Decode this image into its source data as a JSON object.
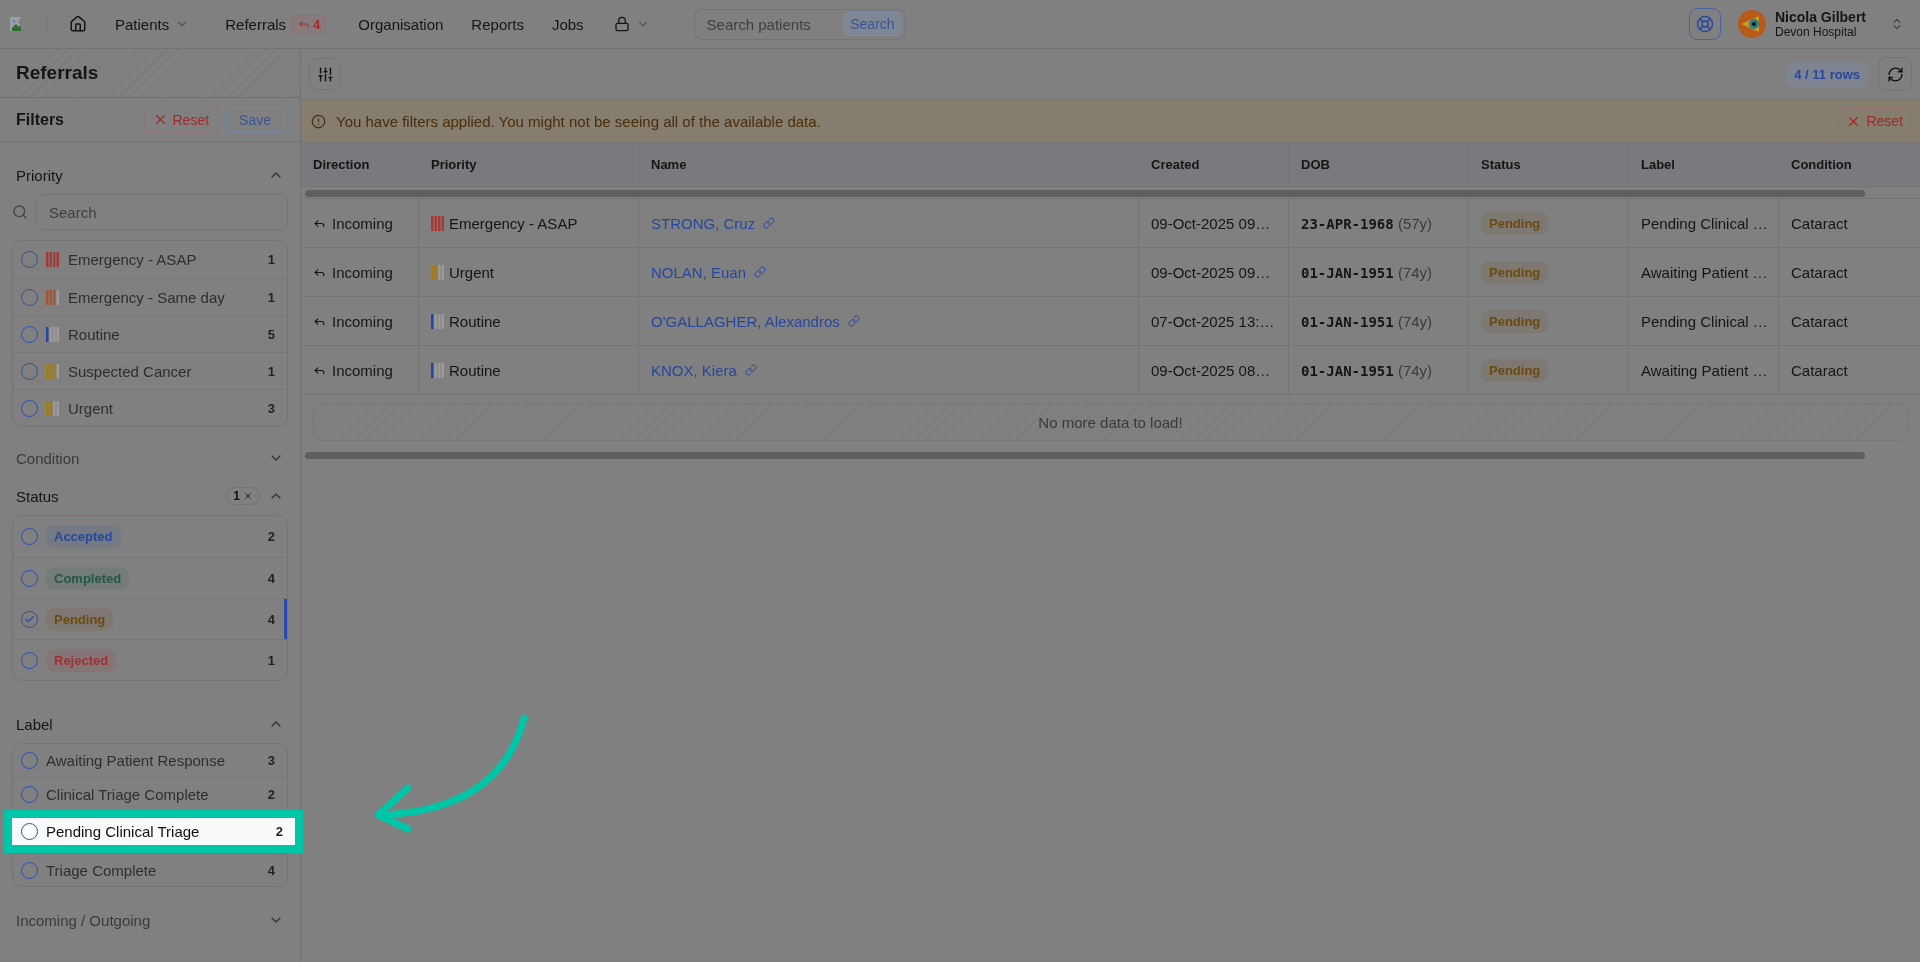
{
  "nav": {
    "items": [
      {
        "kind": "home"
      },
      {
        "kind": "menu",
        "label": "Patients"
      },
      {
        "kind": "badge-link",
        "label": "Referrals",
        "badge": "4"
      },
      {
        "kind": "link",
        "label": "Organisation"
      },
      {
        "kind": "link",
        "label": "Reports"
      },
      {
        "kind": "link",
        "label": "Jobs"
      },
      {
        "kind": "lock-menu"
      }
    ],
    "search": {
      "placeholder": "Search patients",
      "button": "Search"
    },
    "user": {
      "name": "Nicola Gilbert",
      "org": "Devon Hospital"
    }
  },
  "sidebar": {
    "title": "Referrals",
    "filters_title": "Filters",
    "reset": "Reset",
    "save": "Save",
    "sections": [
      {
        "kind": "priority",
        "title": "Priority",
        "expanded": true,
        "search_placeholder": "Search",
        "options": [
          {
            "label": "Emergency - ASAP",
            "count": "1",
            "checked": false,
            "kind": "asap",
            "color": "#a33a3a"
          },
          {
            "label": "Emergency - Same day",
            "count": "1",
            "checked": false,
            "kind": "sameday",
            "color": "#a5552f"
          },
          {
            "label": "Routine",
            "count": "5",
            "checked": false,
            "kind": "routine",
            "color": "#2647a0"
          },
          {
            "label": "Suspected Cancer",
            "count": "1",
            "checked": false,
            "kind": "cancer",
            "color": "#a57c10"
          },
          {
            "label": "Urgent",
            "count": "3",
            "checked": false,
            "kind": "urgent",
            "color": "#a57c10"
          }
        ]
      },
      {
        "kind": "plain",
        "title": "Condition",
        "expanded": false
      },
      {
        "kind": "status",
        "title": "Status",
        "expanded": true,
        "applied": "1",
        "options": [
          {
            "label": "Accepted",
            "count": "2",
            "checked": false,
            "color": "#27489e"
          },
          {
            "label": "Completed",
            "count": "4",
            "checked": false,
            "color": "#1d5a45"
          },
          {
            "label": "Pending",
            "count": "4",
            "checked": true,
            "color": "#6b4a10"
          },
          {
            "label": "Rejected",
            "count": "1",
            "checked": false,
            "color": "#a33030"
          }
        ]
      },
      {
        "kind": "plain",
        "title": "Label",
        "expanded": true,
        "options": [
          {
            "label": "Awaiting Patient Response",
            "count": "3",
            "checked": false,
            "highlighted": false
          },
          {
            "label": "Clinical Triage Complete",
            "count": "2",
            "checked": false,
            "highlighted": false
          },
          {
            "label": "Pending Clinical Triage",
            "count": "2",
            "checked": false,
            "highlighted": true
          },
          {
            "label": "Triage Complete",
            "count": "4",
            "checked": false,
            "highlighted": false
          }
        ]
      },
      {
        "kind": "plain",
        "title": "Incoming / Outgoing",
        "expanded": false
      }
    ]
  },
  "main": {
    "rows_count": "4 / 11 rows",
    "banner": "You have filters applied. You might not be seeing all of the available data.",
    "banner_reset": "Reset",
    "table": {
      "columns": [
        "Direction",
        "Priority",
        "Name",
        "Created",
        "DOB",
        "Status",
        "Label",
        "Condition"
      ],
      "rows": [
        {
          "direction": "Incoming",
          "priority": {
            "label": "Emergency - ASAP",
            "kind": "asap",
            "color": "#a33a3a"
          },
          "name": "STRONG, Cruz",
          "created": "09-Oct-2025 09…",
          "dob": "23-APR-1968",
          "age": "(57y)",
          "status": {
            "label": "Pending",
            "color": "#6b4a10"
          },
          "label": "Pending Clinical …",
          "condition": "Cataract"
        },
        {
          "direction": "Incoming",
          "priority": {
            "label": "Urgent",
            "kind": "urgent",
            "color": "#a57c10"
          },
          "name": "NOLAN, Euan",
          "created": "09-Oct-2025 09…",
          "dob": "01-JAN-1951",
          "age": "(74y)",
          "status": {
            "label": "Pending",
            "color": "#6b4a10"
          },
          "label": "Awaiting Patient …",
          "condition": "Cataract"
        },
        {
          "direction": "Incoming",
          "priority": {
            "label": "Routine",
            "kind": "routine",
            "color": "#2647a0"
          },
          "name": "O'GALLAGHER, Alexandros",
          "created": "07-Oct-2025 13:…",
          "dob": "01-JAN-1951",
          "age": "(74y)",
          "status": {
            "label": "Pending",
            "color": "#6b4a10"
          },
          "label": "Pending Clinical …",
          "condition": "Cataract"
        },
        {
          "direction": "Incoming",
          "priority": {
            "label": "Routine",
            "kind": "routine",
            "color": "#2647a0"
          },
          "name": "KNOX, Kiera",
          "created": "09-Oct-2025 08…",
          "dob": "01-JAN-1951",
          "age": "(74y)",
          "status": {
            "label": "Pending",
            "color": "#6b4a10"
          },
          "label": "Awaiting Patient …",
          "condition": "Cataract"
        }
      ],
      "footer": "No more data to load!"
    }
  }
}
